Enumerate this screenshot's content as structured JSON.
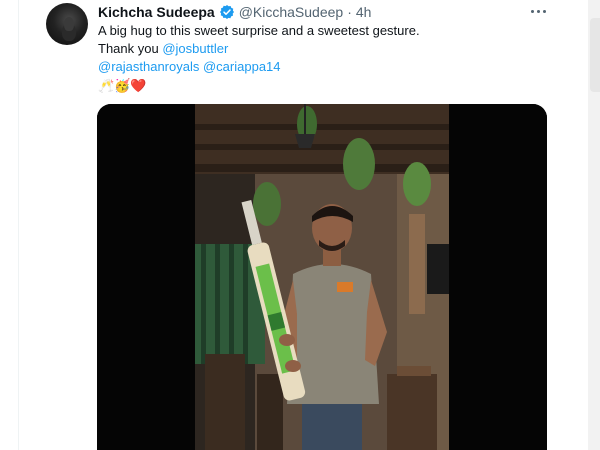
{
  "tweet": {
    "display_name": "Kichcha Sudeepa",
    "handle": "@KicchaSudeep",
    "separator": "·",
    "time": "4h",
    "line1": "A big hug to this sweet surprise and a sweetest gesture.",
    "line2_prefix": "Thank you ",
    "mention1": "@josbuttler",
    "mention2": "@rajasthanroyals",
    "mention3": "@cariappa14",
    "emoji1": "🥂",
    "emoji2": "🥳",
    "emoji3": "❤️"
  },
  "icons": {
    "verified": "verified-badge-icon",
    "more": "more-options-icon"
  },
  "colors": {
    "link": "#1d9bf0",
    "secondary_text": "#536471",
    "verified": "#1d9bf0"
  }
}
